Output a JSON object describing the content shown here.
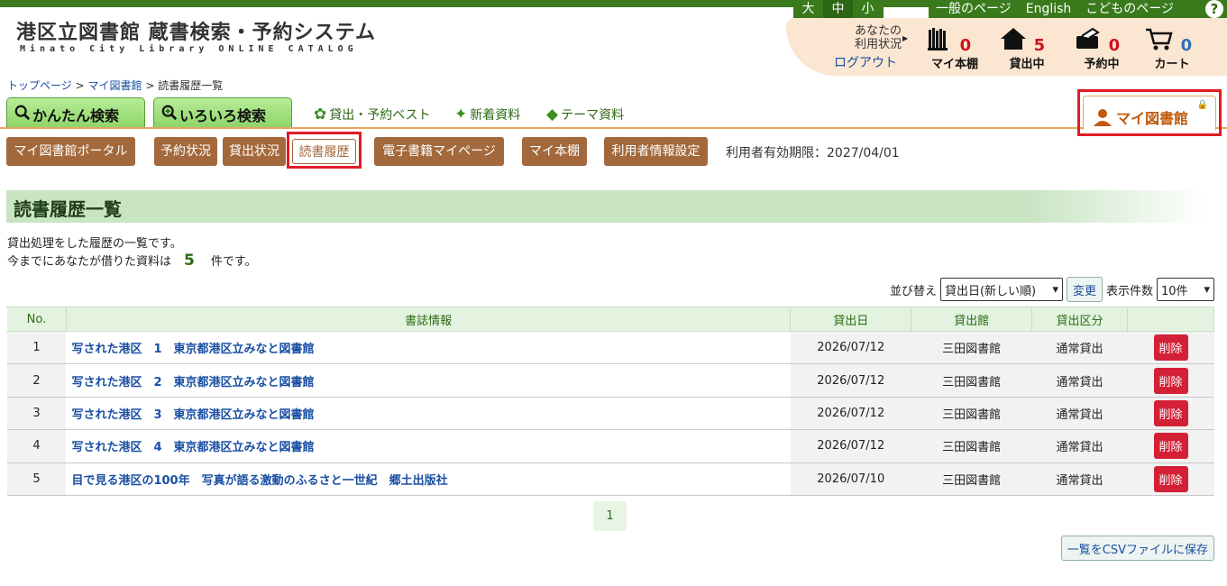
{
  "header": {
    "size_options": [
      "大",
      "中",
      "小"
    ],
    "links": [
      "一般のページ",
      "English",
      "こどものページ"
    ],
    "help_icon": "?",
    "title": "港区立図書館 蔵書検索・予約システム",
    "subtitle": "Minato City Library ONLINE CATALOG",
    "status_label": "あなたの\n利用状況",
    "logout": "ログアウト",
    "stats": [
      {
        "label": "マイ本棚",
        "count": "0",
        "icon": "bookshelf-icon"
      },
      {
        "label": "貸出中",
        "count": "5",
        "icon": "house-icon"
      },
      {
        "label": "予約中",
        "count": "0",
        "icon": "reservation-icon"
      },
      {
        "label": "カート",
        "count": "0",
        "icon": "cart-icon"
      }
    ]
  },
  "breadcrumb": {
    "home": "トップページ",
    "mylib": "マイ図書館",
    "current": "読書履歴一覧",
    "sep": ">"
  },
  "tabs": {
    "simple_search": "かんたん検索",
    "advanced_search": "いろいろ検索",
    "best": "貸出・予約ベスト",
    "new": "新着資料",
    "theme": "テーマ資料",
    "mylib": "マイ図書館"
  },
  "subnav": {
    "items": [
      "マイ図書館ポータル",
      "予約状況",
      "貸出状況",
      "読書履歴",
      "電子書籍マイページ",
      "マイ本棚",
      "利用者情報設定"
    ],
    "expiry": "利用者有効期限：2027/04/01"
  },
  "page": {
    "title": "読書履歴一覧",
    "desc1": "貸出処理をした履歴の一覧です。",
    "desc2_pre": "今までにあなたが借りた資料は",
    "desc2_count": "5",
    "desc2_post": "件です。"
  },
  "sort": {
    "label": "並び替え",
    "value": "貸出日(新しい順)",
    "change": "変更",
    "per_page_label": "表示件数",
    "per_page_value": "10件"
  },
  "table": {
    "headers": [
      "No.",
      "書誌情報",
      "貸出日",
      "貸出館",
      "貸出区分",
      ""
    ],
    "rows": [
      {
        "no": "1",
        "title": "写された港区　1　東京都港区立みなと図書館",
        "date": "2026/07/12",
        "lib": "三田図書館",
        "kind": "通常貸出",
        "action": "削除"
      },
      {
        "no": "2",
        "title": "写された港区　2　東京都港区立みなと図書館",
        "date": "2026/07/12",
        "lib": "三田図書館",
        "kind": "通常貸出",
        "action": "削除"
      },
      {
        "no": "3",
        "title": "写された港区　3　東京都港区立みなと図書館",
        "date": "2026/07/12",
        "lib": "三田図書館",
        "kind": "通常貸出",
        "action": "削除"
      },
      {
        "no": "4",
        "title": "写された港区　4　東京都港区立みなと図書館",
        "date": "2026/07/12",
        "lib": "三田図書館",
        "kind": "通常貸出",
        "action": "削除"
      },
      {
        "no": "5",
        "title": "目で見る港区の100年　写真が語る激動のふるさと一世紀　郷土出版社",
        "date": "2026/07/10",
        "lib": "三田図書館",
        "kind": "通常貸出",
        "action": "削除"
      }
    ]
  },
  "pager": {
    "current": "1"
  },
  "csv_button": "一覧をCSVファイルに保存"
}
